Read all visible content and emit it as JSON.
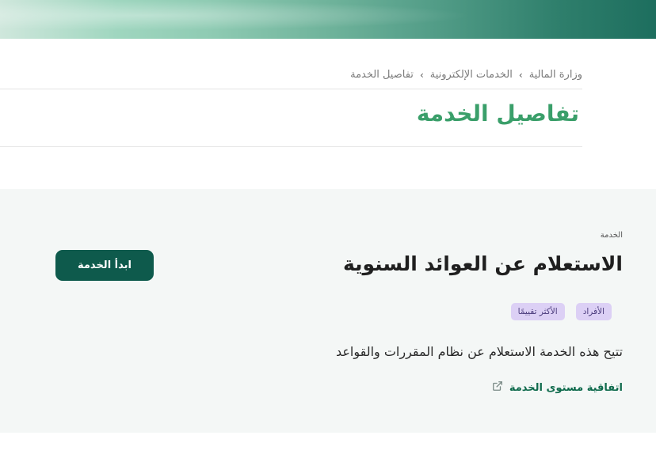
{
  "breadcrumb": {
    "items": [
      "وزارة المالية",
      "الخدمات الإلكترونية",
      "تفاصيل الخدمة"
    ],
    "separator": "›"
  },
  "page": {
    "title": "تفاصيل الخدمة"
  },
  "service": {
    "section_label": "الخدمة",
    "title": "الاستعلام عن العوائد السنوية",
    "start_button_label": "ابدأ الخدمة",
    "tags": [
      "الأفراد",
      "الأكثر تقييمًا"
    ],
    "description": "تتيح هذه الخدمة الاستعلام عن نظام المقررات والقواعد",
    "sla_link_label": "اتفاقية مستوى الخدمة"
  },
  "colors": {
    "brand_green": "#3a9f6a",
    "button_bg": "#0e5a4c",
    "tag_bg": "#dcd0f5",
    "panel_bg": "#f4f7f6"
  },
  "icons": {
    "sla_link": "external-link-icon",
    "breadcrumb_sep": "chevron-left-icon"
  }
}
